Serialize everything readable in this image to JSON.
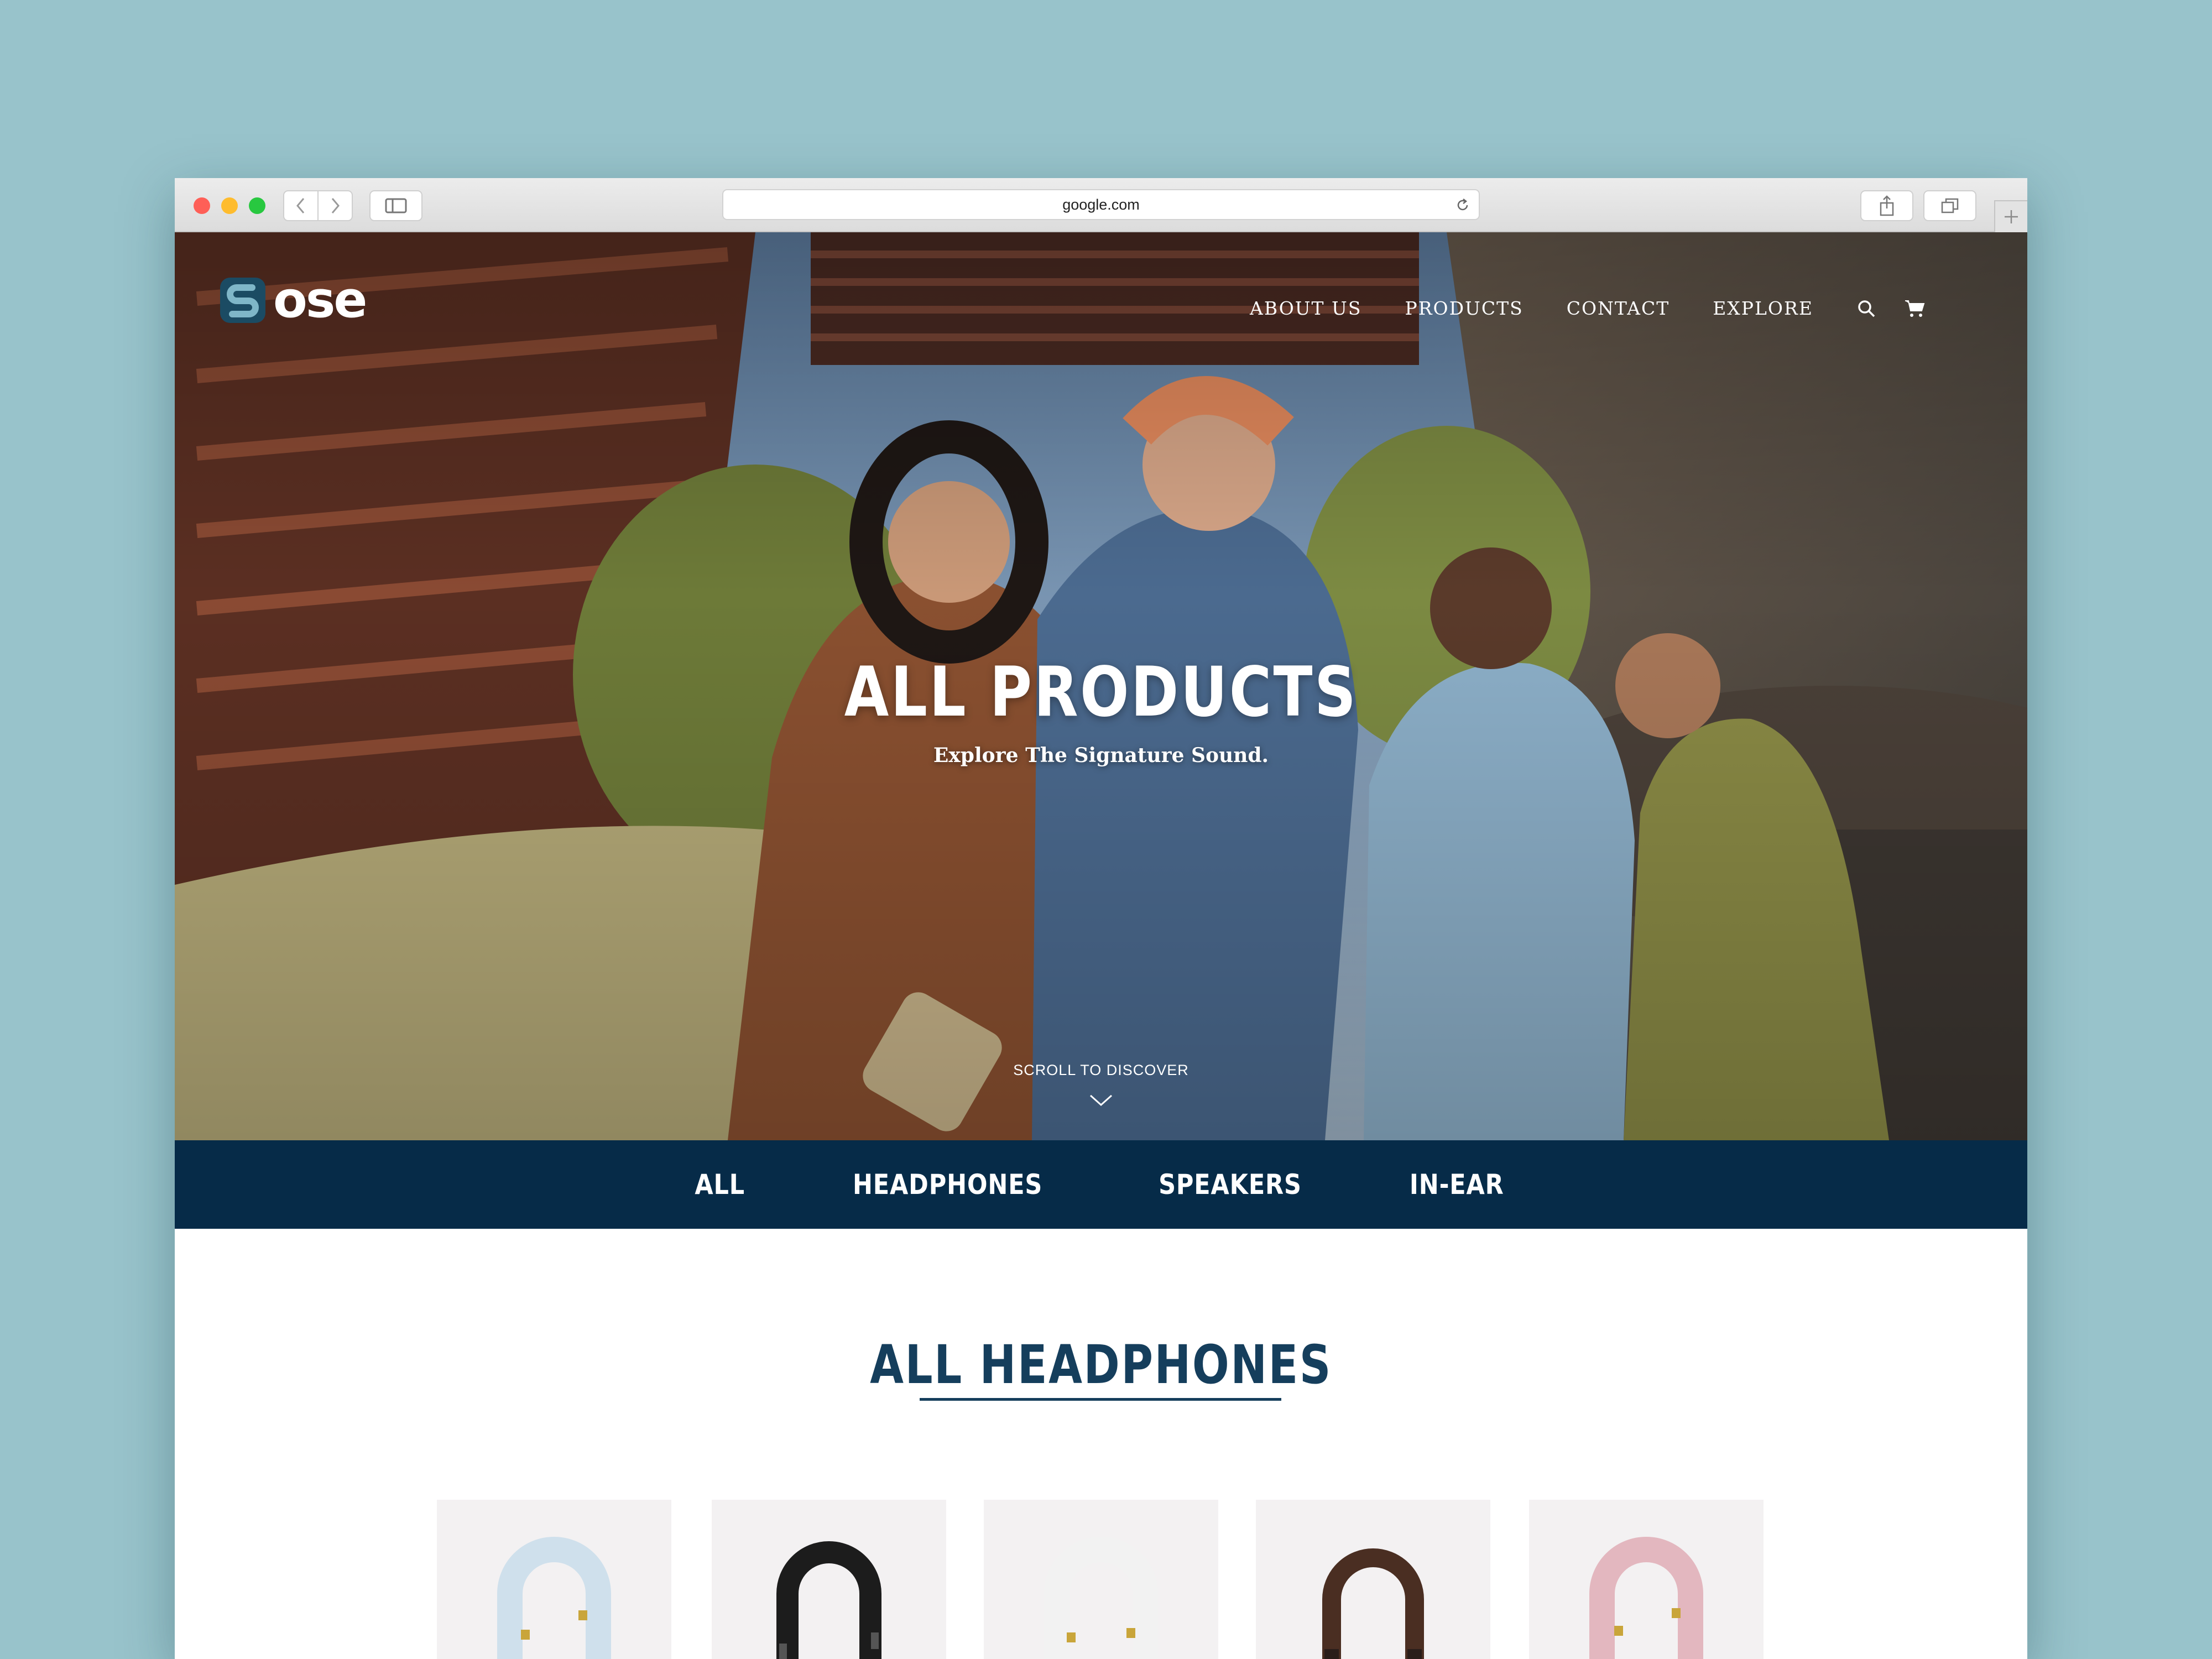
{
  "browser": {
    "url": "google.com",
    "icons": {
      "back": "chevron-left-icon",
      "forward": "chevron-right-icon",
      "sidebar": "sidebar-icon",
      "reload": "reload-icon",
      "share": "share-icon",
      "tabs": "tabs-icon",
      "new_tab": "plus-icon"
    }
  },
  "site": {
    "logo_text": "ose",
    "nav": [
      "ABOUT US",
      "PRODUCTS",
      "CONTACT",
      "EXPLORE"
    ],
    "nav_icons": [
      "search-icon",
      "cart-icon"
    ]
  },
  "hero": {
    "title": "ALL PRODUCTS",
    "subtitle": "Explore The Signature Sound.",
    "scroll_label": "SCROLL TO DISCOVER"
  },
  "categories": [
    "ALL",
    "HEADPHONES",
    "SPEAKERS",
    "IN-EAR"
  ],
  "section": {
    "title": "ALL HEADPHONES"
  },
  "products": [
    {
      "color_name": "light blue",
      "color": "#cfe0ec"
    },
    {
      "color_name": "black",
      "color": "#1c1c1c"
    },
    {
      "color_name": "white",
      "color": "#f2f2f2"
    },
    {
      "color_name": "brown",
      "color": "#4a2e22"
    },
    {
      "color_name": "pink",
      "color": "#e3b7bf"
    }
  ],
  "colors": {
    "background": "#98c3cb",
    "category_bar": "#062b48",
    "heading": "#153e5c",
    "accent_gold": "#c9a53a"
  }
}
